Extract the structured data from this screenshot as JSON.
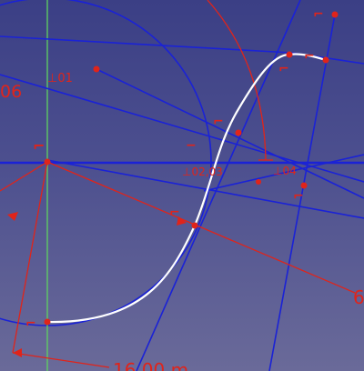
{
  "sketch": {
    "colors": {
      "background_top": "#3b3f85",
      "background_bottom": "#6a6a99",
      "construction_geometry": "#1a22d6",
      "constraints_dimensions": "#e0241a",
      "selected_spline": "#ffffff",
      "vertical_axis": "#5fd35f"
    },
    "dimension_labels": {
      "left_partial": "06",
      "right_partial": "6",
      "bottom_partial": "16.00 m"
    },
    "constraint_labels": {
      "perp_top": "⊥01",
      "perp_middle": "⊥02,03",
      "perp_right": "⊥04"
    },
    "icons": [
      "tangent-constraint-icon",
      "perpendicular-constraint-icon",
      "horizontal-constraint-icon"
    ]
  }
}
